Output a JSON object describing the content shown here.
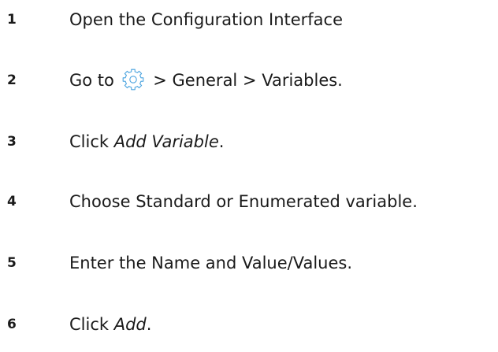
{
  "steps": [
    {
      "number": "1",
      "text": "Open the Configuration Interface"
    },
    {
      "number": "2",
      "text_before": "Go to",
      "icon": "gear-icon",
      "text_after": "> General > Variables."
    },
    {
      "number": "3",
      "text_before": "Click",
      "emphasis": "Add Variable",
      "text_after": "."
    },
    {
      "number": "4",
      "text": "Choose Standard or Enumerated variable."
    },
    {
      "number": "5",
      "text": "Enter the Name and Value/Values."
    },
    {
      "number": "6",
      "text_before": "Click",
      "emphasis": "Add",
      "text_after": "."
    }
  ],
  "colors": {
    "text": "#1a1a1a",
    "icon": "#4aa3df",
    "background": "#ffffff"
  }
}
